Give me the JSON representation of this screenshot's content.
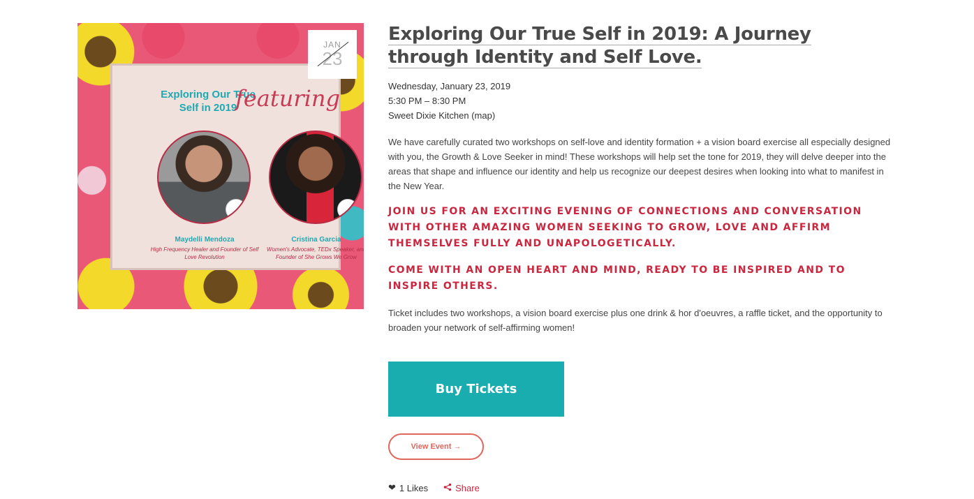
{
  "event": {
    "title": "Exploring Our True Self in 2019: A Journey through Identity and Self Love.",
    "date": "Wednesday, January 23, 2019",
    "time": "5:30 PM – 8:30 PM",
    "location": "Sweet Dixie Kitchen (map)",
    "description": "We have carefully curated two workshops on self-love and identity formation + a vision board exercise all especially designed with you, the Growth & Love Seeker in mind! These workshops will help set the tone for 2019, they will delve deeper into the areas that shape and influence our identity and help us recognize our deepest desires when looking into what to manifest in the New Year.",
    "callout_1": "Join us for an exciting evening of connections and conversation with other amazing women seeking to grow, love and affirm themselves fully and unapologetically.",
    "callout_2": "Come with an open heart and mind, ready to be inspired and to inspire others.",
    "ticket_note": "Ticket includes two workshops, a vision board exercise plus one drink & hor d'oeuvres, a raffle ticket, and the opportunity to broaden your network of self-affirming women!"
  },
  "date_badge": {
    "month": "JAN",
    "day": "23"
  },
  "image": {
    "heading": "Exploring Our True Self in 2019",
    "script": "featuring",
    "speakers": [
      {
        "name": "Maydelli Mendoza",
        "role": "High Frequency Healer and Founder of Self Love Revolution"
      },
      {
        "name": "Cristina Garcia",
        "role": "Women's Advocate, TEDx Speaker, and Founder of She Grows We Grow"
      }
    ]
  },
  "actions": {
    "buy_label": "Buy Tickets",
    "view_label": "View Event →",
    "likes_label": "1 Likes",
    "share_label": "Share"
  },
  "colors": {
    "accent_teal": "#1aadb0",
    "callout_red": "#c9273f",
    "outline_coral": "#e0655b"
  }
}
